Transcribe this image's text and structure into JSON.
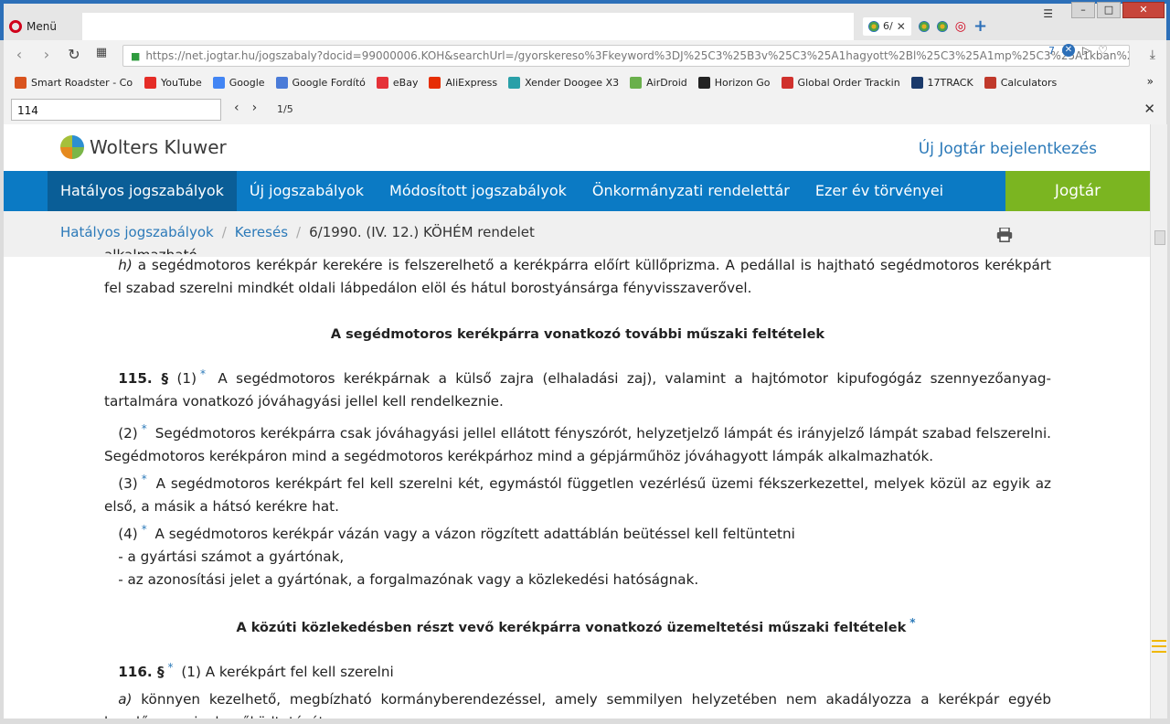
{
  "browser": {
    "menu_label": "Menü",
    "tabs": [
      {
        "label": "6/",
        "active": true
      }
    ],
    "url": "https://net.jogtar.hu/jogszabaly?docid=99000006.KOH&searchUrl=/gyorskereso%3Fkeyword%3DJ%25C3%25B3v%25C3%25A1hagyott%2Bl%25C3%25A1mp%25C3%25A1kban%2Balkalmaz",
    "url_badge": "7",
    "bookmarks": [
      {
        "label": "Smart Roadster - Cor",
        "color": "#d9531e"
      },
      {
        "label": "YouTube",
        "color": "#e52d27"
      },
      {
        "label": "Google",
        "color": "#4285f4"
      },
      {
        "label": "Google Fordító",
        "color": "#4a7bd8"
      },
      {
        "label": "eBay",
        "color": "#e53238"
      },
      {
        "label": "AliExpress",
        "color": "#e62e04"
      },
      {
        "label": "Xender Doogee X3",
        "color": "#2aa0a8"
      },
      {
        "label": "AirDroid",
        "color": "#6ab04c"
      },
      {
        "label": "Horizon Go",
        "color": "#222222"
      },
      {
        "label": "Global Order Tracking",
        "color": "#d0312d"
      },
      {
        "label": "17TRACK",
        "color": "#1b3a6b"
      },
      {
        "label": "Calculators",
        "color": "#c0392b"
      }
    ],
    "find": {
      "query": "114",
      "count": "1/5"
    }
  },
  "site": {
    "logo": "Wolters Kluwer",
    "login": "Új Jogtár bejelentkezés",
    "nav": [
      "Hatályos jogszabályok",
      "Új jogszabályok",
      "Módosított jogszabályok",
      "Önkormányzati rendelettár",
      "Ezer év törvényei"
    ],
    "jogtar": "Jogtár",
    "breadcrumb": {
      "item1": "Hatályos jogszabályok",
      "item2": "Keresés",
      "sep": "/",
      "current": "6/1990. (IV. 12.) KÖHÉM rendelet"
    }
  },
  "doc": {
    "cut_line": "alkalmazható,",
    "h_label": "h)",
    "h_text": "a segédmotoros kerékpár kerekére is felszerelhető a kerékpárra előírt küllőprizma. A pedállal is hajtható segédmotoros kerékpárt fel szabad szerelni mindkét oldali lábpedálon elöl és hátul borostyánsárga fényvisszaverővel.",
    "heading1": "A segédmotoros kerékpárra vonatkozó további műszaki feltételek",
    "s115_num": "115. §",
    "s115_p1_num": "(1)",
    "s115_p1": "A segédmotoros kerékpárnak a külső zajra (elhaladási zaj), valamint a hajtómotor kipufogógáz szennyezőanyag-tartalmára vonatkozó jóváhagyási jellel kell rendelkeznie.",
    "s115_p2_num": "(2)",
    "s115_p2": "Segédmotoros kerékpárra csak jóváhagyási jellel ellátott fényszórót, helyzetjelző lámpát és irányjelző lámpát szabad felszerelni. Segédmotoros kerékpáron mind a segédmotoros kerékpárhoz mind a gépjárműhöz jóváhagyott lámpák alkalmazhatók.",
    "s115_p3_num": "(3)",
    "s115_p3": "A segédmotoros kerékpárt fel kell szerelni két, egymástól független vezérlésű üzemi fékszerkezettel, melyek közül az egyik az első, a másik a hátsó kerékre hat.",
    "s115_p4_num": "(4)",
    "s115_p4": "A segédmotoros kerékpár vázán vagy a vázon rögzített adattáblán beütéssel kell feltüntetni",
    "s115_p4_a": "- a gyártási számot a gyártónak,",
    "s115_p4_b": "- az azonosítási jelet a gyártónak, a forgalmazónak vagy a közlekedési hatóságnak.",
    "heading2": "A közúti közlekedésben részt vevő kerékpárra vonatkozó üzemeltetési műszaki feltételek",
    "s116_num": "116. §",
    "s116_p1": "(1) A kerékpárt fel kell szerelni",
    "s116_a_label": "a)",
    "s116_a": "könnyen kezelhető, megbízható kormányberendezéssel, amely semmilyen helyzetében nem akadályozza a kerékpár egyéb kezelőszerveinek működtetését,",
    "star": "*"
  }
}
